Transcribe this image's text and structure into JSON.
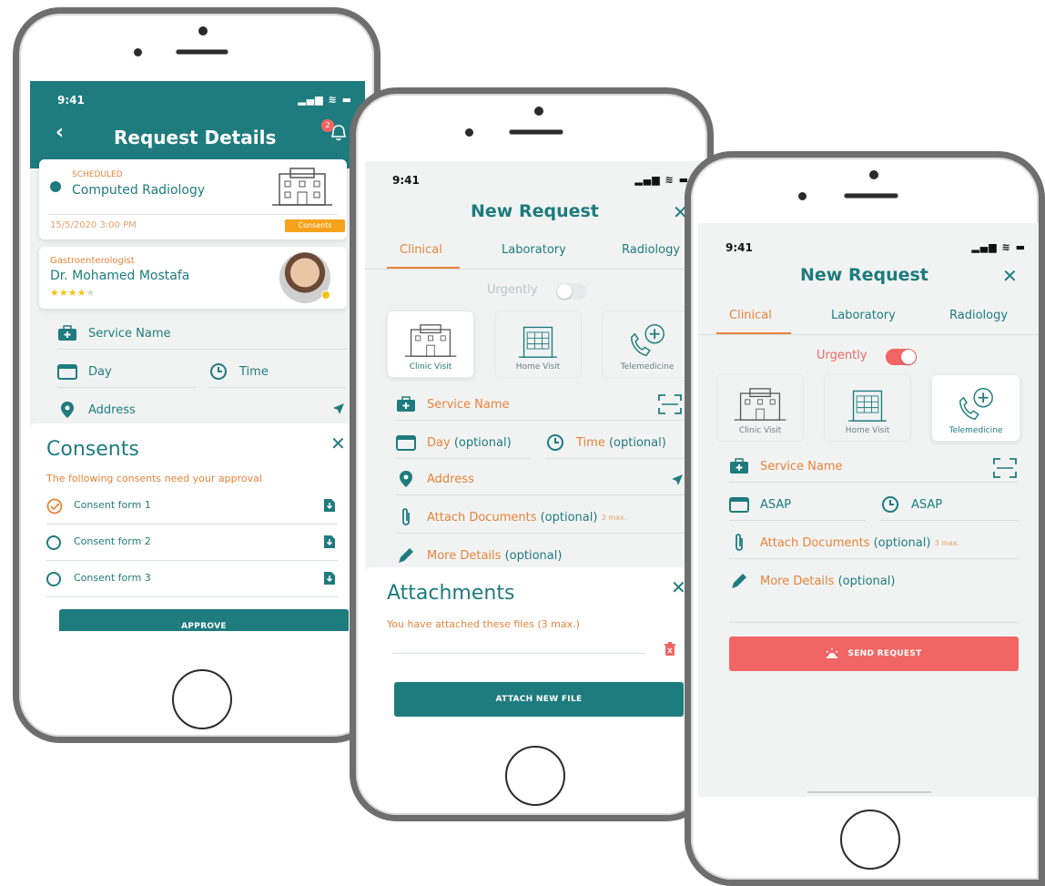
{
  "status_bar": {
    "time": "9:41",
    "icons": "▂▄▆ ≋ ▬"
  },
  "phone1": {
    "title": "Request Details",
    "notification_count": "2",
    "card": {
      "status": "SCHEDULED",
      "name": "Computed Radiology",
      "datetime": "15/5/2020 3:00 PM",
      "badge": "Consents"
    },
    "doctor": {
      "specialty": "Gastroenterologist",
      "name": "Dr. Mohamed Mostafa",
      "stars": "★★★★",
      "star_empty": "★"
    },
    "fields": {
      "service": "Service Name",
      "day": "Day",
      "time": "Time",
      "address": "Address"
    },
    "consents": {
      "title": "Consents",
      "subtitle": "The following consents need your approval",
      "items": [
        "Consent form 1",
        "Consent form 2",
        "Consent form 3"
      ],
      "approve": "APPROVE"
    }
  },
  "phone2": {
    "title": "New Request",
    "tabs": [
      "Clinical",
      "Laboratory",
      "Radiology"
    ],
    "urgently": "Urgently",
    "tiles": [
      "Clinic Visit",
      "Home Visit",
      "Telemedicine"
    ],
    "fields": {
      "service": "Service Name",
      "day": "Day",
      "day_opt": "(optional)",
      "time": "Time",
      "time_opt": "(optional)",
      "address": "Address",
      "attach": "Attach Documents",
      "attach_opt": "(optional)",
      "attach_max": "3 max.",
      "details": "More Details",
      "details_opt": "(optional)"
    },
    "attachments": {
      "title": "Attachments",
      "subtitle": "You have attached these files (3 max.)",
      "button": "ATTACH NEW FILE"
    }
  },
  "phone3": {
    "title": "New Request",
    "tabs": [
      "Clinical",
      "Laboratory",
      "Radiology"
    ],
    "urgently": "Urgently",
    "tiles": [
      "Clinic Visit",
      "Home Visit",
      "Telemedicine"
    ],
    "fields": {
      "service": "Service Name",
      "day": "ASAP",
      "time": "ASAP",
      "attach": "Attach Documents",
      "attach_opt": "(optional)",
      "attach_max": "3 max.",
      "details": "More Details",
      "details_opt": "(optional)"
    },
    "send": "SEND REQUEST"
  },
  "colors": {
    "teal": "#1e7b7e",
    "orange": "#e8833a",
    "red": "#f26565",
    "badge": "#f7a21b"
  }
}
